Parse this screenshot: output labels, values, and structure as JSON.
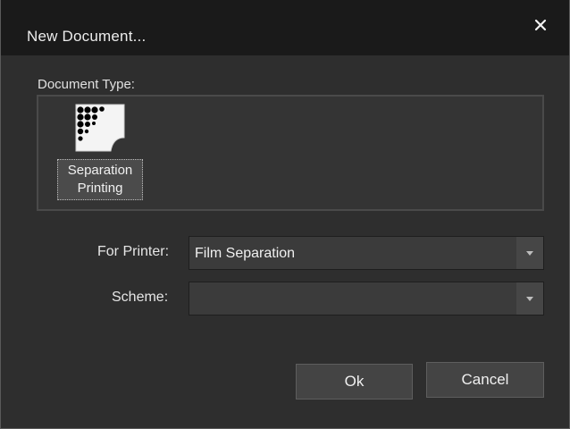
{
  "window": {
    "title": "New Document..."
  },
  "document_type": {
    "section_label": "Document Type:",
    "items": [
      {
        "label_line1": "Separation",
        "label_line2": "Printing",
        "icon": "separation-printing-icon",
        "selected": true
      }
    ]
  },
  "form": {
    "printer_label": "For Printer:",
    "printer_value": "Film Separation",
    "scheme_label": "Scheme:",
    "scheme_value": ""
  },
  "buttons": {
    "ok_label": "Ok",
    "cancel_label": "Cancel"
  },
  "colors": {
    "title_bar": "#1a1a1a",
    "dialog_background": "#2e2e2e",
    "panel_background": "#343434",
    "combo_background": "#3b3b3b",
    "button_background": "#444444"
  }
}
